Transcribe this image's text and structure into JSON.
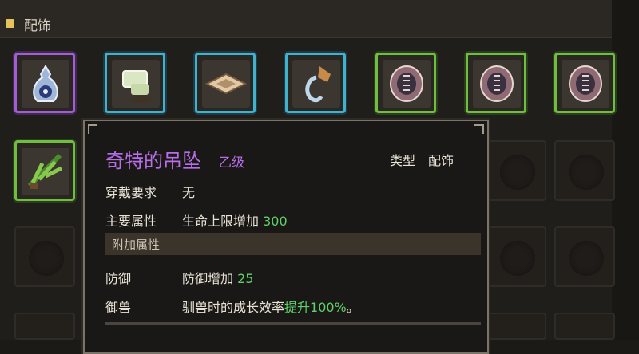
{
  "header": {
    "title": "配饰",
    "accent": "#e6c35a"
  },
  "slots_row1": [
    {
      "icon": "potion-flask-icon",
      "rarity": "purple"
    },
    {
      "icon": "scroll-item-icon",
      "rarity": "cyan"
    },
    {
      "icon": "leather-pad-icon",
      "rarity": "cyan"
    },
    {
      "icon": "bell-hook-icon",
      "rarity": "cyan"
    },
    {
      "icon": "rune-shield-icon",
      "rarity": "green"
    },
    {
      "icon": "rune-shield-icon",
      "rarity": "green"
    },
    {
      "icon": "rune-shield-icon",
      "rarity": "green"
    }
  ],
  "slots_row2": [
    {
      "icon": "herb-bundle-icon",
      "rarity": "green"
    }
  ],
  "tooltip": {
    "name": "奇特的吊坠",
    "grade": "乙级",
    "type_label": "类型",
    "type_value": "配饰",
    "requirement_label": "穿戴要求",
    "requirement_value": "无",
    "main_attr_label": "主要属性",
    "main_attr_text": "生命上限增加",
    "main_attr_value": "300",
    "extra_section": "附加属性",
    "defense_label": "防御",
    "defense_text": "防御增加",
    "defense_value": "25",
    "taming_label": "御兽",
    "taming_text": "驯兽时的成长效率",
    "taming_highlight": "提升100%",
    "taming_suffix": "。",
    "name_color": "#b76ee8",
    "value_color": "#5fd06a"
  }
}
